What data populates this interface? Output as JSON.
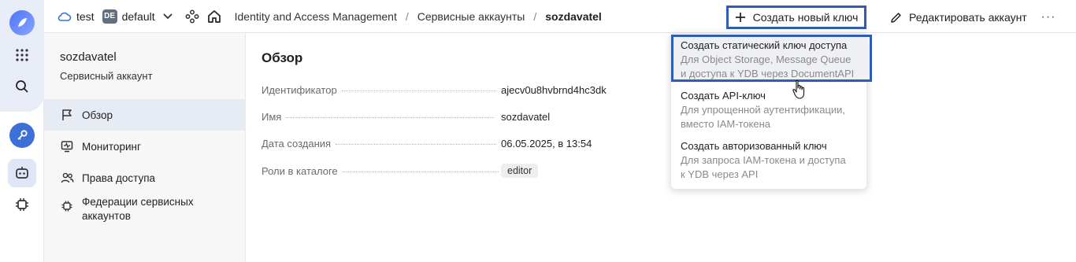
{
  "topbar": {
    "cloud_name": "test",
    "folder_badge": "DE",
    "folder_name": "default",
    "breadcrumbs": [
      "Identity and Access Management",
      "Сервисные аккаунты",
      "sozdavatel"
    ],
    "create_key_label": "Создать новый ключ",
    "edit_account_label": "Редактировать аккаунт",
    "more_label": "···"
  },
  "sidebar": {
    "title": "sozdavatel",
    "subtitle": "Сервисный аккаунт",
    "items": [
      {
        "label": "Обзор",
        "icon": "flag-icon",
        "active": true
      },
      {
        "label": "Мониторинг",
        "icon": "monitor-icon",
        "active": false
      },
      {
        "label": "Права доступа",
        "icon": "users-icon",
        "active": false
      },
      {
        "label": "Федерации сервисных аккаунтов",
        "label_line1": "Федерации сервисных",
        "label_line2": "аккаунтов",
        "icon": "chip-icon",
        "active": false
      }
    ]
  },
  "main": {
    "title": "Обзор",
    "fields": [
      {
        "label": "Идентификатор",
        "value": "ajecv0u8hvbrnd4hc3dk"
      },
      {
        "label": "Имя",
        "value": "sozdavatel"
      },
      {
        "label": "Дата создания",
        "value": "06.05.2025, в 13:54"
      },
      {
        "label": "Роли в каталоге",
        "value": "editor"
      }
    ]
  },
  "dropdown": {
    "items": [
      {
        "title": "Создать статический ключ доступа",
        "desc_line1": "Для Object Storage, Message Queue",
        "desc_line2": "и доступа к YDB через DocumentAPI"
      },
      {
        "title": "Создать API-ключ",
        "desc_line1": "Для упрощенной аутентификации,",
        "desc_line2": "вместо IAM-токена"
      },
      {
        "title": "Создать авторизованный ключ",
        "desc_line1": "Для запроса IAM-токена и доступа",
        "desc_line2": "к YDB через API"
      }
    ]
  },
  "colors": {
    "accent": "#2f5db5",
    "active_nav": "#e6ebf4",
    "rail_bg": "#e8edf7"
  }
}
